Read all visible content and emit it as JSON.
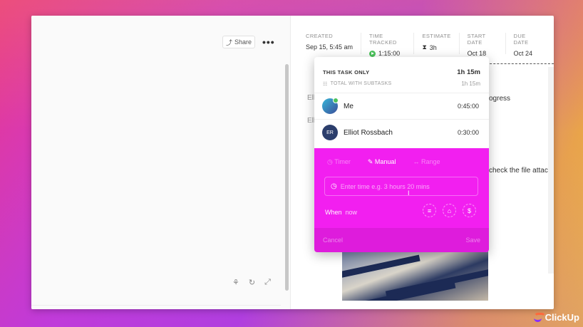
{
  "header": {
    "share_label": "Share",
    "more_label": "•••"
  },
  "meta": [
    {
      "label": "CREATED",
      "value": "Sep 15, 5:45 am"
    },
    {
      "label": "TIME TRACKED",
      "value": "1:15:00"
    },
    {
      "label": "ESTIMATE",
      "value": "3h"
    },
    {
      "label": "START DATE",
      "value": "Oct 18"
    },
    {
      "label": "DUE DATE",
      "value": "Oct 24"
    }
  ],
  "background": {
    "elli_1": "Elli",
    "elli_2": "Elli",
    "ogress": "ogress",
    "check_text": "check the file attac"
  },
  "popup": {
    "this_task_label": "THIS TASK ONLY",
    "this_task_value": "1h 15m",
    "subtasks_label": "TOTAL WITH SUBTASKS",
    "subtasks_value": "1h 15m",
    "users": [
      {
        "name": "Me",
        "time": "0:45:00",
        "initials": ""
      },
      {
        "name": "Elliot Rossbach",
        "time": "0:30:00",
        "initials": "ER"
      }
    ],
    "tabs": [
      "Timer",
      "Manual",
      "Range"
    ],
    "input_placeholder": "Enter time e.g. 3 hours 20 mins",
    "when_label": "When",
    "when_value": "now",
    "cancel_label": "Cancel",
    "save_label": "Save"
  },
  "brand": {
    "name": "ClickUp"
  },
  "colors": {
    "accent_magenta": "#f21ff0",
    "running_green": "#4bc35b"
  }
}
